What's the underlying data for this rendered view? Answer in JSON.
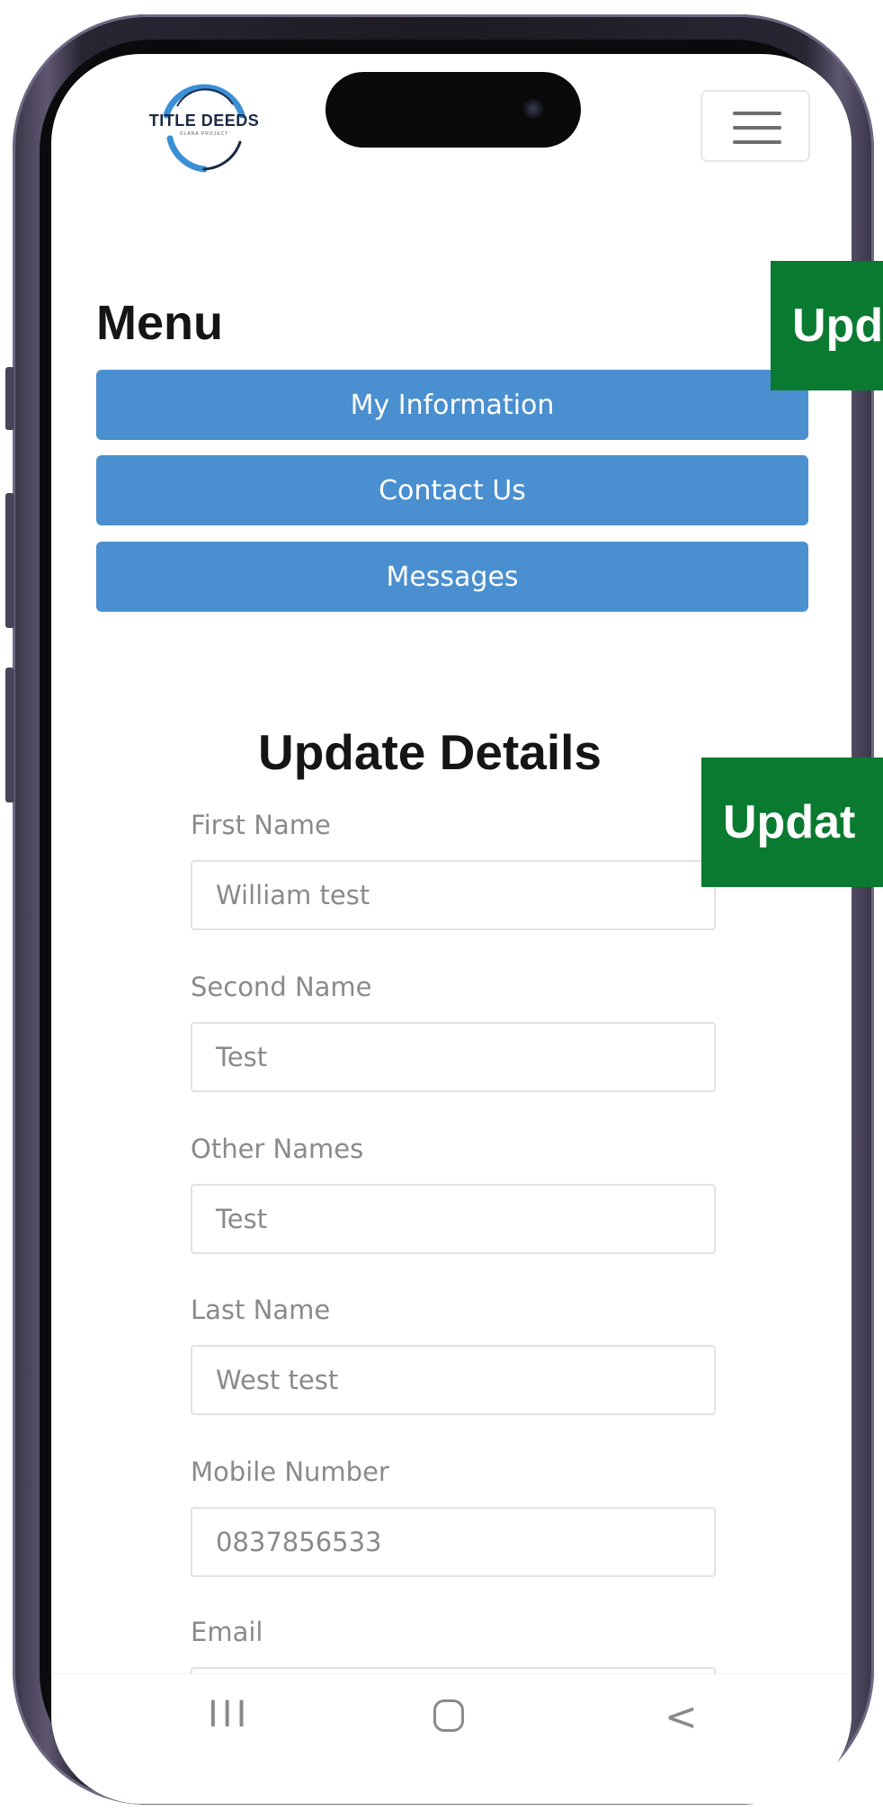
{
  "header": {
    "logo_text": "TITLE DEEDS",
    "logo_subtitle": "OLANA PROJECT"
  },
  "overlays": {
    "top_tag": "Upd",
    "middle_tag": "Updat"
  },
  "menu": {
    "title": "Menu",
    "items": [
      {
        "label": "My Information"
      },
      {
        "label": "Contact Us"
      },
      {
        "label": "Messages"
      }
    ]
  },
  "form": {
    "title": "Update Details",
    "fields": [
      {
        "label": "First Name",
        "value": "William test"
      },
      {
        "label": "Second Name",
        "value": "Test"
      },
      {
        "label": "Other Names",
        "value": "Test"
      },
      {
        "label": "Last Name",
        "value": "West test"
      },
      {
        "label": "Mobile Number",
        "value": "0837856533"
      },
      {
        "label": "Email",
        "value": ""
      }
    ]
  },
  "nav": {
    "recent": "III",
    "back": "<"
  },
  "colors": {
    "menu_button": "#4a8fcf",
    "overlay_green": "#0a7a30",
    "logo_ring_blue": "#3a8fd6"
  }
}
